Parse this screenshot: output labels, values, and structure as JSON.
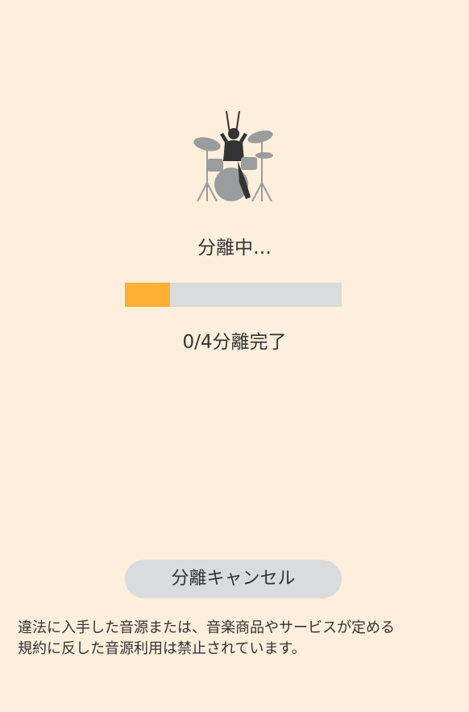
{
  "status": {
    "label": "分離中…"
  },
  "progress": {
    "completed": 0,
    "total": 4,
    "fill_fraction": 0.21,
    "count_label": "0/4分離完了"
  },
  "actions": {
    "cancel_label": "分離キャンセル"
  },
  "notice": {
    "text": "違法に入手した音源または、音楽商品やサービスが定める\n規約に反した音源利用は禁止されています。"
  },
  "icons": {
    "drum": "drummer-silhouette-icon"
  },
  "colors": {
    "background": "#fdefdc",
    "progress_fill": "#fdb034",
    "progress_track": "#d9dbdc",
    "button_bg": "#d9dbdc",
    "text": "#333333"
  }
}
